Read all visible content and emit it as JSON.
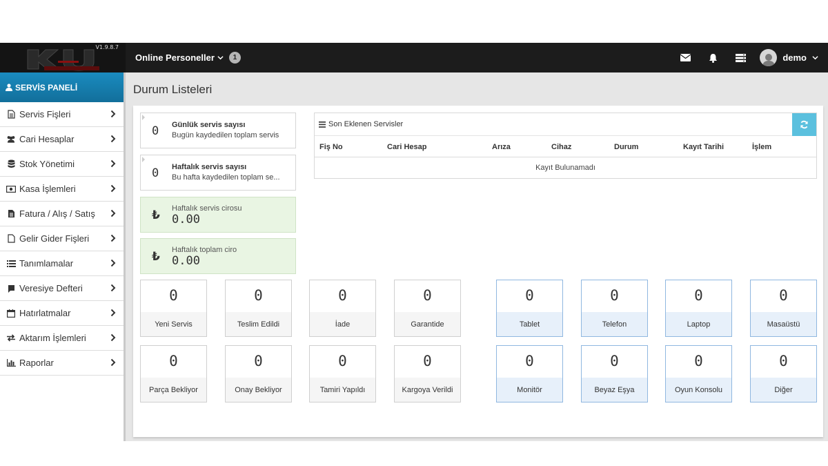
{
  "app": {
    "version": "V1.9.8.7",
    "logo_text": "KAYAOĞLU"
  },
  "topbar": {
    "online_label": "Online Personeller",
    "online_count": "1",
    "user_name": "demo",
    "icons": [
      "envelope-icon",
      "bell-icon",
      "server-icon",
      "user-avatar-icon"
    ]
  },
  "sidebar": {
    "header": "SERVİS PANELİ",
    "items": [
      {
        "label": "Servis Fişleri",
        "icon": "file-text-icon"
      },
      {
        "label": "Cari Hesaplar",
        "icon": "users-icon"
      },
      {
        "label": "Stok Yönetimi",
        "icon": "database-icon"
      },
      {
        "label": "Kasa İşlemleri",
        "icon": "money-icon"
      },
      {
        "label": "Fatura / Alış / Satış",
        "icon": "file-icon"
      },
      {
        "label": "Gelir Gider Fişleri",
        "icon": "file-o-icon"
      },
      {
        "label": "Tanımlamalar",
        "icon": "list-icon"
      },
      {
        "label": "Veresiye Defteri",
        "icon": "book-icon"
      },
      {
        "label": "Hatırlatmalar",
        "icon": "calendar-icon"
      },
      {
        "label": "Aktarım İşlemleri",
        "icon": "exchange-icon"
      },
      {
        "label": "Raporlar",
        "icon": "bar-chart-icon"
      }
    ]
  },
  "main": {
    "title": "Durum Listeleri",
    "stats": [
      {
        "value": "0",
        "title": "Günlük servis sayısı",
        "subtitle": "Bugün kaydedilen toplam servis"
      },
      {
        "value": "0",
        "title": "Haftalık servis sayısı",
        "subtitle": "Bu hafta kaydedilen toplam se..."
      },
      {
        "currency": "₺",
        "title": "Haftalık servis cirosu",
        "amount": "0.00"
      },
      {
        "currency": "₺",
        "title": "Haftalık toplam ciro",
        "amount": "0.00"
      }
    ],
    "recent": {
      "title": "Son Eklenen Servisler",
      "columns": [
        "Fiş No",
        "Cari Hesap",
        "Arıza",
        "Cihaz",
        "Durum",
        "Kayıt Tarihi",
        "İşlem"
      ],
      "empty_text": "Kayıt Bulunamadı"
    },
    "status_tiles": [
      {
        "value": "0",
        "label": "Yeni Servis"
      },
      {
        "value": "0",
        "label": "Teslim Edildi"
      },
      {
        "value": "0",
        "label": "İade"
      },
      {
        "value": "0",
        "label": "Garantide"
      },
      {
        "value": "0",
        "label": "Parça Bekliyor"
      },
      {
        "value": "0",
        "label": "Onay Bekliyor"
      },
      {
        "value": "0",
        "label": "Tamiri Yapıldı"
      },
      {
        "value": "0",
        "label": "Kargoya Verildi"
      }
    ],
    "device_tiles": [
      {
        "value": "0",
        "label": "Tablet"
      },
      {
        "value": "0",
        "label": "Telefon"
      },
      {
        "value": "0",
        "label": "Laptop"
      },
      {
        "value": "0",
        "label": "Masaüstü"
      },
      {
        "value": "0",
        "label": "Monitör"
      },
      {
        "value": "0",
        "label": "Beyaz Eşya"
      },
      {
        "value": "0",
        "label": "Oyun Konsolu"
      },
      {
        "value": "0",
        "label": "Diğer"
      }
    ]
  },
  "colors": {
    "topbar": "#1c1c1c",
    "panel_header": "#1580b1",
    "refresh_button": "#5bc0de",
    "green_card": "#e9f5e3",
    "blue_tile_border": "#8fb7e0"
  }
}
